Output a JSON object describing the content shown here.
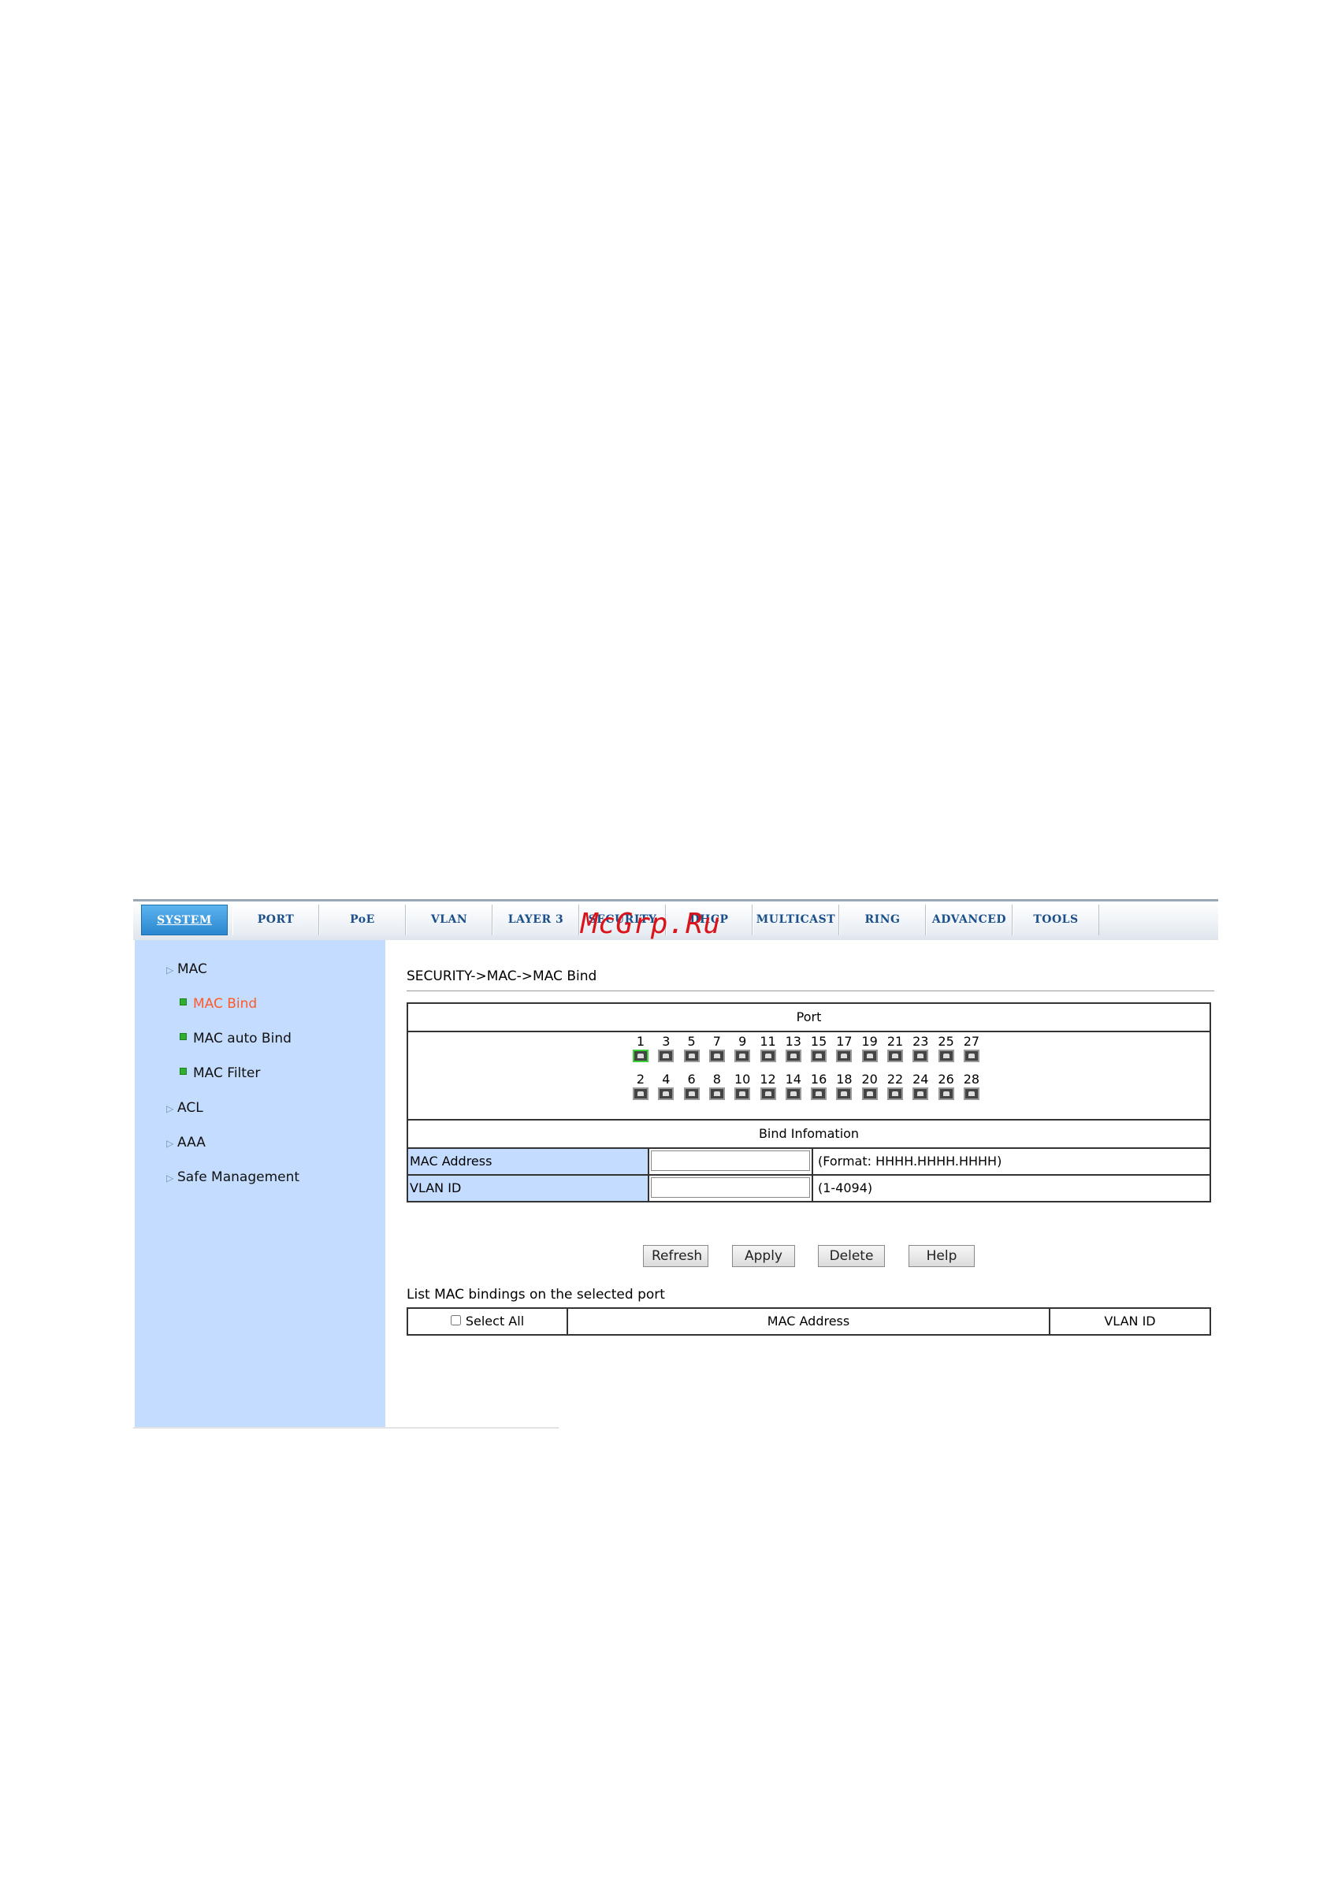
{
  "tabs": [
    "SYSTEM",
    "PORT",
    "PoE",
    "VLAN",
    "LAYER 3",
    "SECURITY",
    "DHCP",
    "MULTICAST",
    "RING",
    "ADVANCED",
    "TOOLS"
  ],
  "active_tab": "SYSTEM",
  "watermark": "McGrp.Ru",
  "sidebar": {
    "mac": "MAC",
    "mac_bind": "MAC Bind",
    "mac_auto_bind": "MAC auto Bind",
    "mac_filter": "MAC Filter",
    "acl": "ACL",
    "aaa": "AAA",
    "safe_management": "Safe Management"
  },
  "breadcrumb": "SECURITY->MAC->MAC Bind",
  "port_panel": {
    "title": "Port",
    "odd_ports": [
      "1",
      "3",
      "5",
      "7",
      "9",
      "11",
      "13",
      "15",
      "17",
      "19",
      "21",
      "23",
      "25",
      "27"
    ],
    "even_ports": [
      "2",
      "4",
      "6",
      "8",
      "10",
      "12",
      "14",
      "16",
      "18",
      "20",
      "22",
      "24",
      "26",
      "28"
    ],
    "selected_port": "1"
  },
  "bind_info": {
    "title": "Bind Infomation",
    "mac_label": "MAC Address",
    "mac_value": "",
    "mac_hint": "(Format: HHHH.HHHH.HHHH)",
    "vlan_label": "VLAN ID",
    "vlan_value": "",
    "vlan_hint": "(1-4094)"
  },
  "buttons": {
    "refresh": "Refresh",
    "apply": "Apply",
    "delete": "Delete",
    "help": "Help"
  },
  "list": {
    "caption": "List MAC bindings on the selected port",
    "select_all": "Select All",
    "col_mac": "MAC Address",
    "col_vlan": "VLAN ID"
  },
  "colors": {
    "sidebar_bg": "#c4dcff",
    "active_link": "#ff5a2a",
    "watermark": "#d9141a"
  }
}
